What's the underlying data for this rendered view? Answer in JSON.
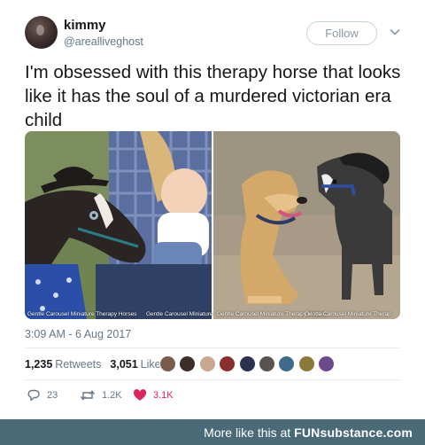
{
  "author": {
    "display_name": "kimmy",
    "handle": "@arealliveghost",
    "avatar": "avatar"
  },
  "follow_button": {
    "label": "Follow"
  },
  "tweet": {
    "text": "I'm obsessed with this therapy horse that looks like it has the soul of a murdered victorian era child",
    "timestamp": "3:09 AM - 6 Aug 2017"
  },
  "media": {
    "left_credits": [
      "Gentle Carousel Miniature Therapy Horses",
      "Gentle Carousel Miniature"
    ],
    "right_credits": [
      "Gentle Carousel Miniature Therapy Horses",
      "Gentle Carousel Miniature Therap"
    ]
  },
  "stats": {
    "retweets_count": "1,235",
    "retweets_label": "Retweets",
    "likes_count": "3,051",
    "likes_label": "Likes"
  },
  "actions": {
    "reply_count": "23",
    "retweet_count": "1.2K",
    "like_count": "3.1K"
  },
  "icons": {
    "caret": "chevron-down-icon",
    "reply": "reply-icon",
    "retweet": "retweet-icon",
    "like": "heart-icon"
  },
  "colors": {
    "primary_text": "#14171a",
    "secondary_text": "#657786",
    "like_red": "#e0245e",
    "footer_bg": "#4a6a78"
  },
  "footer": {
    "text": "More like this at",
    "brand": "FUNsubstance.com"
  }
}
